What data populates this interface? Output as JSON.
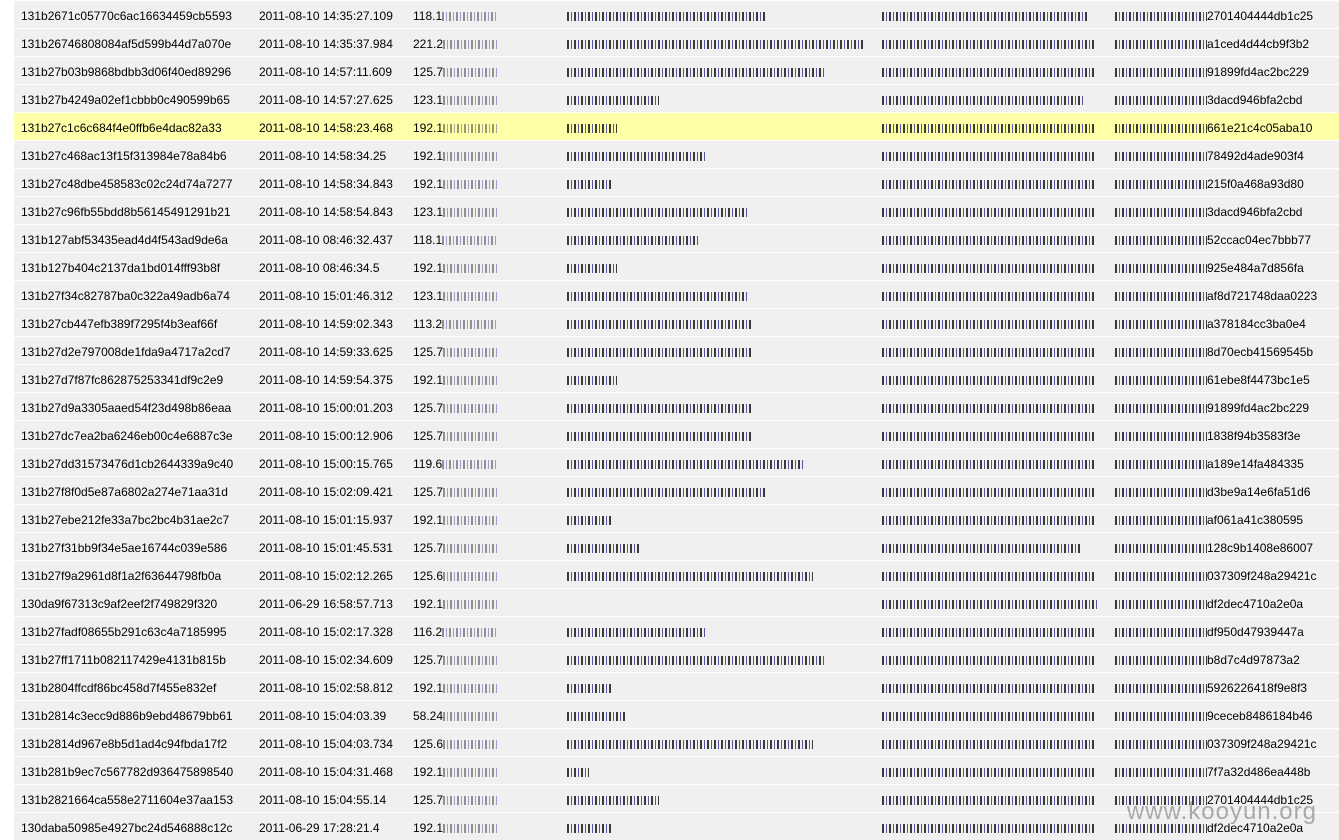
{
  "selected_index": 4,
  "watermark": "www.kooyun.org",
  "rows": [
    {
      "id": "131b2671c05770c6ac16634459cb5593",
      "time": "2011-08-10 14:35:27.109",
      "ip": "118.1",
      "ua_w": 200,
      "h1_w": 206,
      "h2_prefix": "",
      "h2_suffix": "2701404444db1c25"
    },
    {
      "id": "131b26746808084af5d599b44d7a070e",
      "time": "2011-08-10 14:35:37.984",
      "ip": "221.2",
      "ua_w": 296,
      "h1_w": 212,
      "h2_prefix": "",
      "h2_suffix": "a1ced4d44cb9f3b2"
    },
    {
      "id": "131b27b03b9868bdbb3d06f40ed89296",
      "time": "2011-08-10 14:57:11.609",
      "ip": "125.7",
      "ua_w": 258,
      "h1_w": 212,
      "h2_prefix": "",
      "h2_suffix": "91899fd4ac2bc229"
    },
    {
      "id": "131b27b4249a02ef1cbbb0c490599b65",
      "time": "2011-08-10 14:57:27.625",
      "ip": "123.1",
      "ua_w": 92,
      "h1_w": 202,
      "h2_prefix": "",
      "h2_suffix": "3dacd946bfa2cbd"
    },
    {
      "id": "131b27c1c6c684f4e0ffb6e4dac82a33",
      "time": "2011-08-10 14:58:23.468",
      "ip": "192.1",
      "ua_w": 50,
      "h1_w": 212,
      "h2_prefix": "",
      "h2_suffix": "661e21c4c05aba10"
    },
    {
      "id": "131b27c468ac13f15f313984e78a84b6",
      "time": "2011-08-10 14:58:34.25",
      "ip": "192.1",
      "ua_w": 140,
      "h1_w": 212,
      "h2_prefix": "",
      "h2_suffix": "78492d4ade903f4"
    },
    {
      "id": "131b27c48dbe458583c02c24d74a7277",
      "time": "2011-08-10 14:58:34.843",
      "ip": "192.1",
      "ua_w": 46,
      "h1_w": 212,
      "h2_prefix": "",
      "h2_suffix": "215f0a468a93d80"
    },
    {
      "id": "131b27c96fb55bdd8b56145491291b21",
      "time": "2011-08-10 14:58:54.843",
      "ip": "123.1",
      "ua_w": 182,
      "h1_w": 212,
      "h2_prefix": "",
      "h2_suffix": "3dacd946bfa2cbd"
    },
    {
      "id": "131b127abf53435ead4d4f543ad9de6a",
      "time": "2011-08-10 08:46:32.437",
      "ip": "118.1",
      "ua_w": 132,
      "h1_w": 212,
      "h2_prefix": "",
      "h2_suffix": "52ccac04ec7bbb77"
    },
    {
      "id": "131b127b404c2137da1bd014fff93b8f",
      "time": "2011-08-10 08:46:34.5",
      "ip": "192.1",
      "ua_w": 50,
      "h1_w": 212,
      "h2_prefix": "",
      "h2_suffix": "925e484a7d856fa"
    },
    {
      "id": "131b27f34c82787ba0c322a49adb6a74",
      "time": "2011-08-10 15:01:46.312",
      "ip": "123.1",
      "ua_w": 182,
      "h1_w": 212,
      "h2_prefix": "",
      "h2_suffix": "af8d721748daa0223"
    },
    {
      "id": "131b27cb447efb389f7295f4b3eaf66f",
      "time": "2011-08-10 14:59:02.343",
      "ip": "113.2",
      "ua_w": 186,
      "h1_w": 212,
      "h2_prefix": "",
      "h2_suffix": "a378184cc3ba0e4"
    },
    {
      "id": "131b27d2e797008de1fda9a4717a2cd7",
      "time": "2011-08-10 14:59:33.625",
      "ip": "125.7",
      "ua_w": 186,
      "h1_w": 212,
      "h2_prefix": "",
      "h2_suffix": "8d70ecb41569545b"
    },
    {
      "id": "131b27d7f87fc862875253341df9c2e9",
      "time": "2011-08-10 14:59:54.375",
      "ip": "192.1",
      "ua_w": 50,
      "h1_w": 212,
      "h2_prefix": "",
      "h2_suffix": "61ebe8f4473bc1e5"
    },
    {
      "id": "131b27d9a3305aaed54f23d498b86eaa",
      "time": "2011-08-10 15:00:01.203",
      "ip": "125.7",
      "ua_w": 186,
      "h1_w": 212,
      "h2_prefix": "",
      "h2_suffix": "91899fd4ac2bc229"
    },
    {
      "id": "131b27dc7ea2ba6246eb00c4e6887c3e",
      "time": "2011-08-10 15:00:12.906",
      "ip": "125.7",
      "ua_w": 186,
      "h1_w": 212,
      "h2_prefix": "",
      "h2_suffix": "1838f94b3583f3e"
    },
    {
      "id": "131b27dd31573476d1cb2644339a9c40",
      "time": "2011-08-10 15:00:15.765",
      "ip": "119.6",
      "ua_w": 236,
      "h1_w": 212,
      "h2_prefix": "",
      "h2_suffix": "a189e14fa484335"
    },
    {
      "id": "131b27f8f0d5e87a6802a274e71aa31d",
      "time": "2011-08-10 15:02:09.421",
      "ip": "125.7",
      "ua_w": 198,
      "h1_w": 212,
      "h2_prefix": "",
      "h2_suffix": "d3be9a14e6fa51d6"
    },
    {
      "id": "131b27ebe212fe33a7bc2bc4b31ae2c7",
      "time": "2011-08-10 15:01:15.937",
      "ip": "192.1",
      "ua_w": 46,
      "h1_w": 212,
      "h2_prefix": "",
      "h2_suffix": "af061a41c380595"
    },
    {
      "id": "131b27f31bb9f34e5ae16744c039e586",
      "time": "2011-08-10 15:01:45.531",
      "ip": "125.7",
      "ua_w": 72,
      "h1_w": 200,
      "h2_prefix": "",
      "h2_suffix": "128c9b1408e86007"
    },
    {
      "id": "131b27f9a2961d8f1a2f63644798fb0a",
      "time": "2011-08-10 15:02:12.265",
      "ip": "125.6",
      "ua_w": 246,
      "h1_w": 212,
      "h2_prefix": "",
      "h2_suffix": "037309f248a29421c"
    },
    {
      "id": "130da9f67313c9af2eef2f749829f320",
      "time": "2011-06-29 16:58:57.713",
      "ip": "192.1",
      "ua_w": 0,
      "h1_w": 216,
      "h2_prefix": "",
      "h2_suffix": "df2dec4710a2e0a"
    },
    {
      "id": "131b27fadf08655b291c63c4a7185995",
      "time": "2011-08-10 15:02:17.328",
      "ip": "116.2",
      "ua_w": 140,
      "h1_w": 212,
      "h2_prefix": "",
      "h2_suffix": "df950d47939447a"
    },
    {
      "id": "131b27ff1711b082117429e4131b815b",
      "time": "2011-08-10 15:02:34.609",
      "ip": "125.7",
      "ua_w": 258,
      "h1_w": 212,
      "h2_prefix": "",
      "h2_suffix": "b8d7c4d97873a2"
    },
    {
      "id": "131b2804ffcdf86bc458d7f455e832ef",
      "time": "2011-08-10 15:02:58.812",
      "ip": "192.1",
      "ua_w": 46,
      "h1_w": 212,
      "h2_prefix": "",
      "h2_suffix": "5926226418f9e8f3"
    },
    {
      "id": "131b2814c3ecc9d886b9ebd48679bb61",
      "time": "2011-08-10 15:04:03.39",
      "ip": "58.24",
      "ua_w": 60,
      "h1_w": 212,
      "h2_prefix": "",
      "h2_suffix": "9ceceb8486184b46"
    },
    {
      "id": "131b2814d967e8b5d1ad4c94fbda17f2",
      "time": "2011-08-10 15:04:03.734",
      "ip": "125.6",
      "ua_w": 246,
      "h1_w": 212,
      "h2_prefix": "",
      "h2_suffix": "037309f248a29421c"
    },
    {
      "id": "131b281b9ec7c567782d936475898540",
      "time": "2011-08-10 15:04:31.468",
      "ip": "192.1",
      "ua_w": 22,
      "h1_w": 212,
      "h2_prefix": "",
      "h2_suffix": "7f7a32d486ea448b"
    },
    {
      "id": "131b2821664ca558e2711604e37aa153",
      "time": "2011-08-10 15:04:55.14",
      "ip": "125.7",
      "ua_w": 92,
      "h1_w": 212,
      "h2_prefix": "",
      "h2_suffix": "2701404444db1c25"
    },
    {
      "id": "130daba50985e4927bc24d546888c12c",
      "time": "2011-06-29 17:28:21.4",
      "ip": "192.1",
      "ua_w": 46,
      "h1_w": 212,
      "h2_prefix": "",
      "h2_suffix": "df2dec4710a2e0a"
    }
  ]
}
